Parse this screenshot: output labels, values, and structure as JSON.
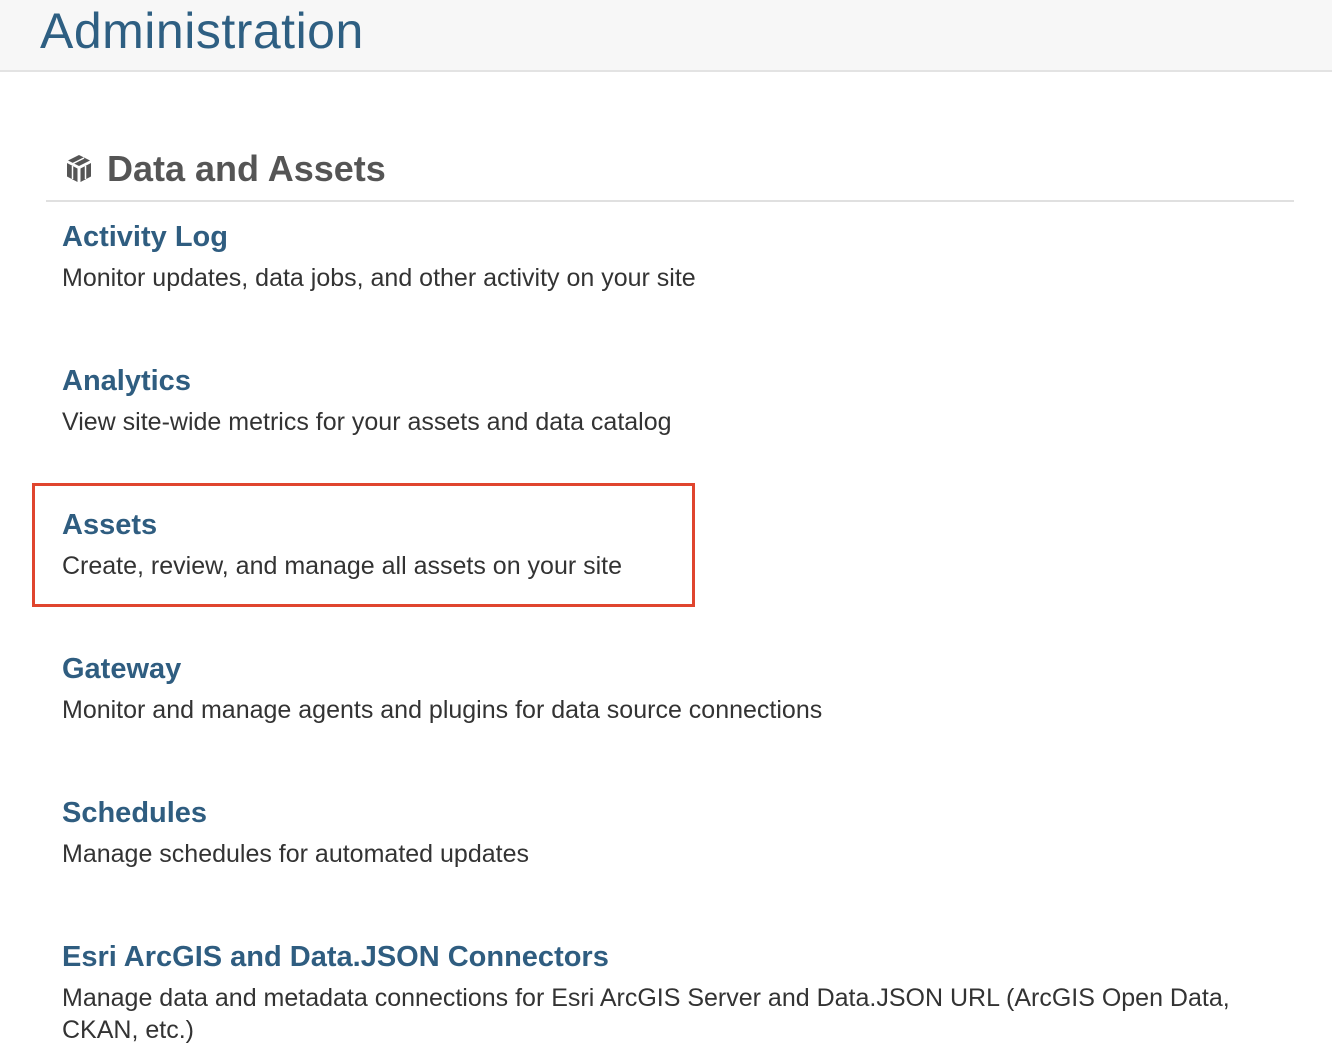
{
  "header": {
    "title": "Administration"
  },
  "section": {
    "icon": "cube-icon",
    "title": "Data and Assets"
  },
  "items": [
    {
      "title": "Activity Log",
      "description": "Monitor updates, data jobs, and other activity on your site"
    },
    {
      "title": "Analytics",
      "description": "View site-wide metrics for your assets and data catalog"
    },
    {
      "title": "Assets",
      "description": "Create, review, and manage all assets on your site"
    },
    {
      "title": "Gateway",
      "description": "Monitor and manage agents and plugins for data source connections"
    },
    {
      "title": "Schedules",
      "description": "Manage schedules for automated updates"
    },
    {
      "title": "Esri ArcGIS and Data.JSON Connectors",
      "description": "Manage data and metadata connections for Esri ArcGIS Server and Data.JSON URL (ArcGIS Open Data, CKAN, etc.)"
    }
  ],
  "colors": {
    "title": "#2e5f82",
    "link": "#2f5d80",
    "highlight": "#e0452e"
  }
}
